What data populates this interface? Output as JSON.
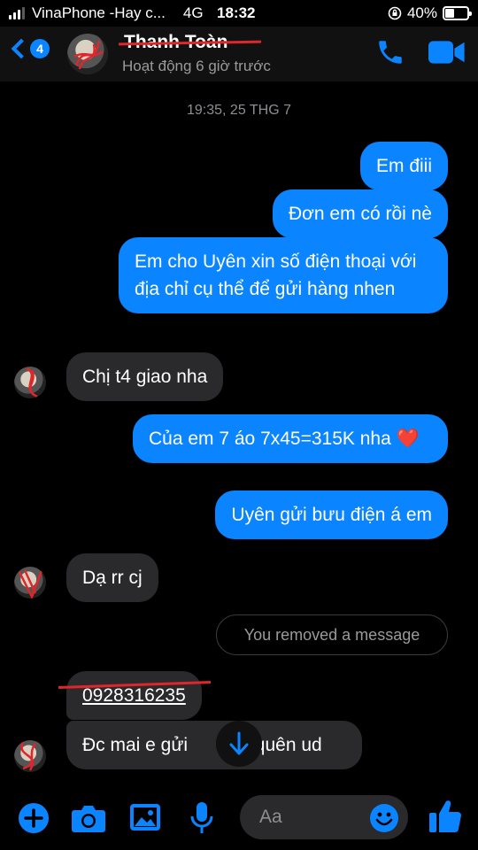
{
  "status_bar": {
    "carrier": "VinaPhone -Hay c...",
    "network": "4G",
    "time": "18:32",
    "battery": "40%",
    "battery_level": 0.4
  },
  "header": {
    "back_count": "4",
    "contact_name": "Thanh Toàn",
    "contact_status": "Hoạt động 6 giờ trước"
  },
  "chat": {
    "date": "19:35, 25 THG 7",
    "messages": [
      {
        "text": "Em điii"
      },
      {
        "text": "Đơn em có rồi nè"
      },
      {
        "text": "Em cho Uyên xin số điện thoại với địa chỉ cụ thể để gửi hàng nhen"
      },
      {
        "text": "Chị t4 giao nha"
      },
      {
        "text": "Của em 7 áo 7x45=315K nha ❤️"
      },
      {
        "text": "Uyên gửi bưu điện á em"
      },
      {
        "text": "Dạ rr cj"
      },
      {
        "text": "0928316235"
      },
      {
        "text": "Đc mai e gửi"
      },
      {
        "text": "quên ud"
      }
    ],
    "removed_notice": "You removed a message"
  },
  "composer": {
    "placeholder": "Aa"
  },
  "colors": {
    "accent": "#0a84ff",
    "incoming_bubble": "#2a2a2c",
    "redaction": "#e0262a"
  },
  "icons": [
    "plus-icon",
    "camera-icon",
    "image-icon",
    "microphone-icon",
    "emoji-icon",
    "thumbs-up-icon",
    "phone-icon",
    "video-icon",
    "arrow-down-icon"
  ]
}
